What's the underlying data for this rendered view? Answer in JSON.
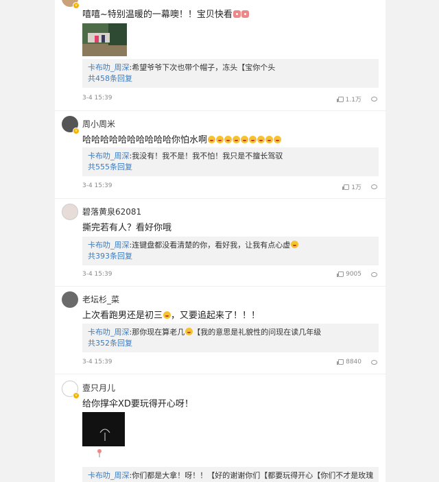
{
  "comments": [
    {
      "username": "",
      "text": "嘻嘻~特别温暖的一幕噢！！宝贝快看",
      "reply_user": "卡布叻_周深",
      "reply_text": ":希望爷爷下次也带个帽子，冻头【宝你个头",
      "reply_count": "共458条回复",
      "time": "3-4 15:39",
      "likes": "1.1万"
    },
    {
      "username": "周小周米",
      "text": "哈哈哈哈哈哈哈哈哈哈你怕水啊",
      "reply_user": "卡布叻_周深",
      "reply_text": ":我没有！我不是！我不怕！我只是不擅长驾驭",
      "reply_count": "共555条回复",
      "time": "3-4 15:39",
      "likes": "1万"
    },
    {
      "username": "碧落黄泉62081",
      "text": "撕完若有人？看好你哦",
      "reply_user": "卡布叻_周深",
      "reply_text": ":连键盘都没看清楚的你，看好我，让我有点心虚",
      "reply_count": "共393条回复",
      "time": "3-4 15:39",
      "likes": "9005"
    },
    {
      "username": "老坛杉_菜",
      "text_before": "上次看跑男还是初三",
      "text_after": "，又要追起来了！！！",
      "reply_user": "卡布叻_周深",
      "reply_text": ":那你现在算老几",
      "reply_text_after": "【我的意思是礼貌性的问现在读几年级",
      "reply_count": "共352条回复",
      "time": "3-4 15:39",
      "likes": "8840"
    },
    {
      "username": "壹只月儿",
      "text": "给你撑伞XD要玩得开心呀！",
      "reply_user": "卡布叻_周深",
      "reply_text": ":你们都是大拿！呀！！【好的谢谢你们【都要玩得开心【你们不才是玫瑰呀"
    }
  ],
  "colors": {
    "link": "#3b7bbf",
    "reply_bg": "#f2f2f2",
    "badge": "#f6b400"
  },
  "icons": [
    "thumb-up-icon",
    "comment-bubble-icon",
    "verified-badge-icon",
    "emoji-icon"
  ]
}
